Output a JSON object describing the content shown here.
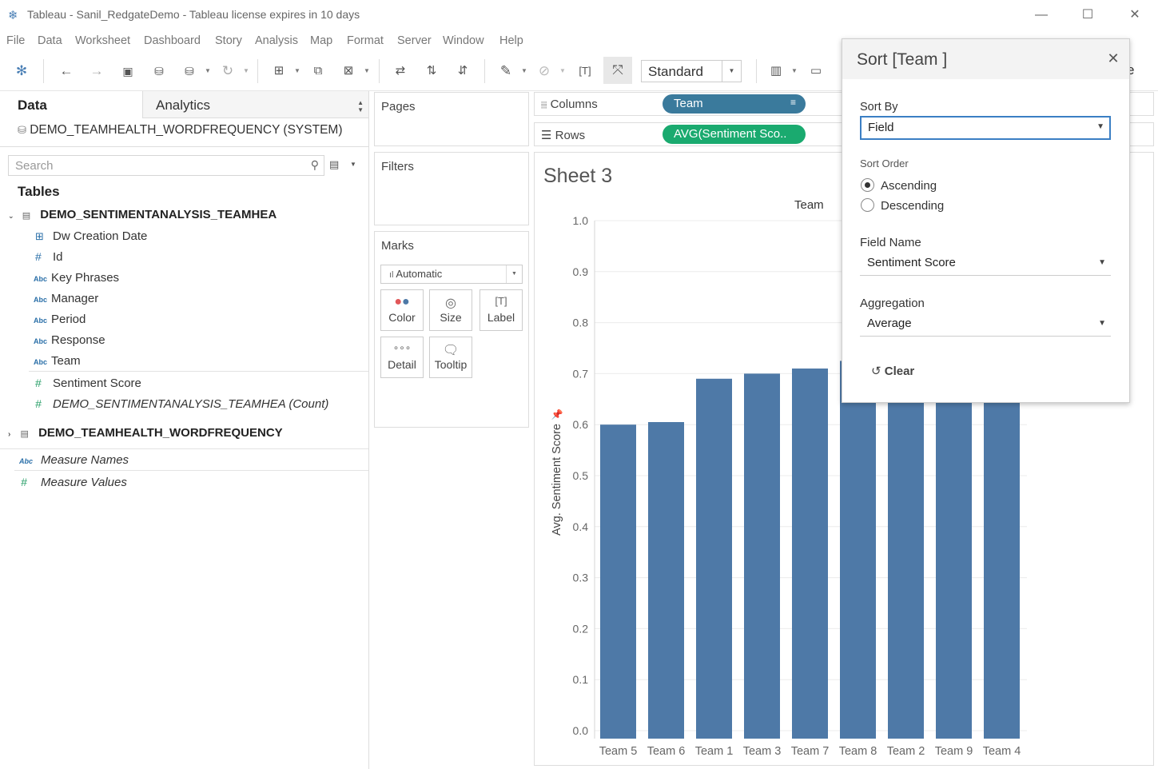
{
  "window": {
    "title": "Tableau - Sanil_RedgateDemo - Tableau license expires in 10 days",
    "minimize": "—",
    "maximize": "☐",
    "close": "✕"
  },
  "menu": [
    "File",
    "Data",
    "Worksheet",
    "Dashboard",
    "Story",
    "Analysis",
    "Map",
    "Format",
    "Server",
    "Window",
    "Help"
  ],
  "toolbar": {
    "fit_value": "Standard",
    "show_me_partial": "e"
  },
  "data_pane": {
    "tab_data": "Data",
    "tab_analytics": "Analytics",
    "datasource": "DEMO_TEAMHEALTH_WORDFREQUENCY (SYSTEM)",
    "search_placeholder": "Search",
    "tables_header": "Tables",
    "table1": {
      "name": "DEMO_SENTIMENTANALYSIS_TEAMHEA",
      "dimensions": [
        {
          "type": "date",
          "label": "Dw Creation Date"
        },
        {
          "type": "number",
          "label": "Id"
        },
        {
          "type": "string",
          "label": "Key Phrases"
        },
        {
          "type": "string",
          "label": "Manager"
        },
        {
          "type": "string",
          "label": "Period"
        },
        {
          "type": "string",
          "label": "Response"
        },
        {
          "type": "string",
          "label": "Team"
        }
      ],
      "measures": [
        {
          "type": "number",
          "label": "Sentiment Score"
        },
        {
          "type": "number",
          "label": "DEMO_SENTIMENTANALYSIS_TEAMHEA (Count)"
        }
      ]
    },
    "table2": {
      "name": "DEMO_TEAMHEALTH_WORDFREQUENCY"
    },
    "measure_names": "Measure Names",
    "measure_values": "Measure Values",
    "string_icon": "Abc",
    "number_icon": "#"
  },
  "shelves": {
    "pages": "Pages",
    "filters": "Filters",
    "marks": "Marks",
    "mark_type": "Automatic",
    "mark_buttons": [
      "Color",
      "Size",
      "Label",
      "Detail",
      "Tooltip"
    ],
    "columns_label": "Columns",
    "rows_label": "Rows",
    "columns_pill": "Team",
    "rows_pill": "AVG(Sentiment Sco..",
    "columns_color": "#3a7a9c",
    "rows_color": "#1aaa6f"
  },
  "viz": {
    "sheet_title": "Sheet 3",
    "column_header": "Team",
    "bar_color": "#4e79a7"
  },
  "chart_data": {
    "type": "bar",
    "title": "Sheet 3",
    "xlabel": "Team",
    "ylabel": "Avg. Sentiment Score",
    "categories": [
      "Team 5",
      "Team 6",
      "Team 1",
      "Team 3",
      "Team 7",
      "Team 8",
      "Team 2",
      "Team 9",
      "Team 4"
    ],
    "values": [
      0.6,
      0.605,
      0.69,
      0.7,
      0.71,
      0.725,
      0.74,
      0.75,
      0.76
    ],
    "ylim": [
      0,
      1.0
    ],
    "yticks": [
      "0.0",
      "0.1",
      "0.2",
      "0.3",
      "0.4",
      "0.5",
      "0.6",
      "0.7",
      "0.8",
      "0.9",
      "1.0"
    ],
    "grid": true
  },
  "sort_dialog": {
    "title": "Sort [Team ]",
    "close": "✕",
    "sort_by_label": "Sort By",
    "sort_by_value": "Field",
    "sort_order_label": "Sort Order",
    "ascending": "Ascending",
    "descending": "Descending",
    "field_name_label": "Field Name",
    "field_name_value": "Sentiment Score",
    "aggregation_label": "Aggregation",
    "aggregation_value": "Average",
    "clear_label": "Clear"
  }
}
